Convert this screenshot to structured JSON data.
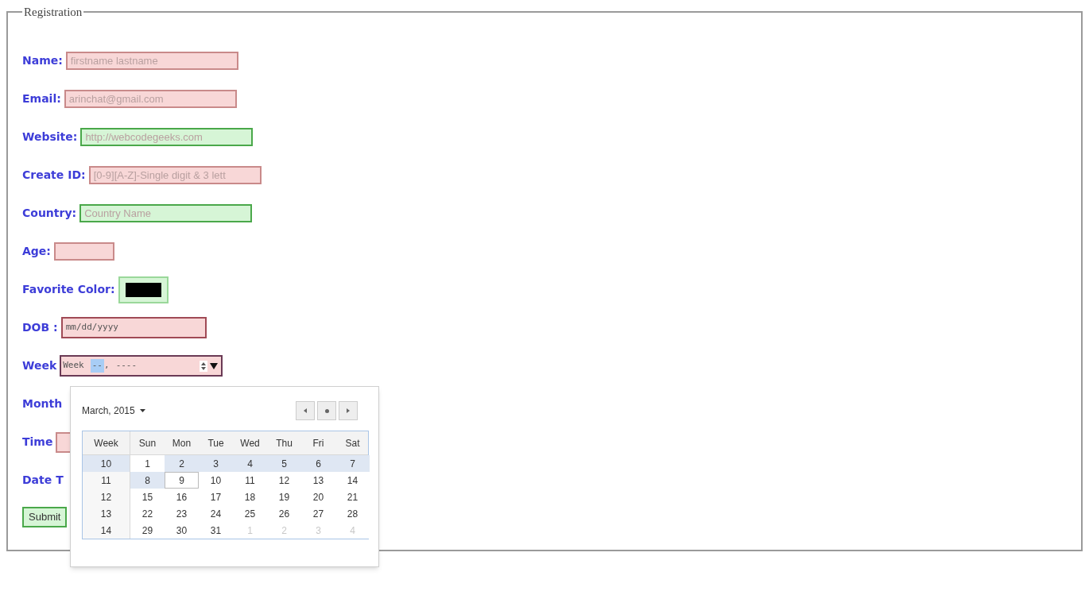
{
  "form": {
    "legend": "Registration",
    "fields": [
      {
        "kind": "text",
        "label": "Name:",
        "placeholder": "firstname lastname",
        "valid": false
      },
      {
        "kind": "text",
        "label": "Email:",
        "placeholder": "arinchat@gmail.com",
        "valid": false
      },
      {
        "kind": "text",
        "label": "Website:",
        "placeholder": "http://webcodegeeks.com",
        "valid": true
      },
      {
        "kind": "text",
        "label": "Create ID:",
        "placeholder": "[0-9][A-Z]-Single digit & 3 lett",
        "valid": false
      },
      {
        "kind": "text",
        "label": "Country:",
        "placeholder": "Country Name",
        "valid": true
      },
      {
        "kind": "number",
        "label": "Age:",
        "valid": false
      },
      {
        "kind": "color",
        "label": "Favorite Color:",
        "color": "#000000",
        "valid": true
      },
      {
        "kind": "date",
        "label": "DOB :",
        "placeholder": "mm/dd/yyyy",
        "valid": false
      },
      {
        "kind": "week",
        "label": "Week",
        "prefix": "Week",
        "week_value": "--",
        "separator": ",",
        "year_value": "----",
        "valid": false
      },
      {
        "kind": "hidden",
        "label": "Month"
      },
      {
        "kind": "time",
        "label": "Time",
        "valid": false
      },
      {
        "kind": "hidden",
        "label": "Date T"
      }
    ],
    "submit": {
      "label": "Submit",
      "valid": true
    }
  },
  "week_picker": {
    "month": "March, 2015",
    "columns": [
      "Week",
      "Sun",
      "Mon",
      "Tue",
      "Wed",
      "Thu",
      "Fri",
      "Sat"
    ],
    "rows": [
      {
        "week": "10",
        "selected": true,
        "days": [
          {
            "day": "1",
            "selected": false,
            "today": false,
            "dimmed": false
          },
          {
            "day": "2",
            "selected": true,
            "today": false,
            "dimmed": false
          },
          {
            "day": "3",
            "selected": true,
            "today": false,
            "dimmed": false
          },
          {
            "day": "4",
            "selected": true,
            "today": false,
            "dimmed": false
          },
          {
            "day": "5",
            "selected": true,
            "today": false,
            "dimmed": false
          },
          {
            "day": "6",
            "selected": true,
            "today": false,
            "dimmed": false
          },
          {
            "day": "7",
            "selected": true,
            "today": false,
            "dimmed": false
          }
        ]
      },
      {
        "week": "11",
        "selected": false,
        "days": [
          {
            "day": "8",
            "selected": true,
            "today": false,
            "dimmed": false
          },
          {
            "day": "9",
            "selected": false,
            "today": true,
            "dimmed": false
          },
          {
            "day": "10",
            "selected": false,
            "today": false,
            "dimmed": false
          },
          {
            "day": "11",
            "selected": false,
            "today": false,
            "dimmed": false
          },
          {
            "day": "12",
            "selected": false,
            "today": false,
            "dimmed": false
          },
          {
            "day": "13",
            "selected": false,
            "today": false,
            "dimmed": false
          },
          {
            "day": "14",
            "selected": false,
            "today": false,
            "dimmed": false
          }
        ]
      },
      {
        "week": "12",
        "selected": false,
        "days": [
          {
            "day": "15",
            "selected": false,
            "today": false,
            "dimmed": false
          },
          {
            "day": "16",
            "selected": false,
            "today": false,
            "dimmed": false
          },
          {
            "day": "17",
            "selected": false,
            "today": false,
            "dimmed": false
          },
          {
            "day": "18",
            "selected": false,
            "today": false,
            "dimmed": false
          },
          {
            "day": "19",
            "selected": false,
            "today": false,
            "dimmed": false
          },
          {
            "day": "20",
            "selected": false,
            "today": false,
            "dimmed": false
          },
          {
            "day": "21",
            "selected": false,
            "today": false,
            "dimmed": false
          }
        ]
      },
      {
        "week": "13",
        "selected": false,
        "days": [
          {
            "day": "22",
            "selected": false,
            "today": false,
            "dimmed": false
          },
          {
            "day": "23",
            "selected": false,
            "today": false,
            "dimmed": false
          },
          {
            "day": "24",
            "selected": false,
            "today": false,
            "dimmed": false
          },
          {
            "day": "25",
            "selected": false,
            "today": false,
            "dimmed": false
          },
          {
            "day": "26",
            "selected": false,
            "today": false,
            "dimmed": false
          },
          {
            "day": "27",
            "selected": false,
            "today": false,
            "dimmed": false
          },
          {
            "day": "28",
            "selected": false,
            "today": false,
            "dimmed": false
          }
        ]
      },
      {
        "week": "14",
        "selected": false,
        "days": [
          {
            "day": "29",
            "selected": false,
            "today": false,
            "dimmed": false
          },
          {
            "day": "30",
            "selected": false,
            "today": false,
            "dimmed": false
          },
          {
            "day": "31",
            "selected": false,
            "today": false,
            "dimmed": false
          },
          {
            "day": "1",
            "selected": false,
            "today": false,
            "dimmed": true
          },
          {
            "day": "2",
            "selected": false,
            "today": false,
            "dimmed": true
          },
          {
            "day": "3",
            "selected": false,
            "today": false,
            "dimmed": true
          },
          {
            "day": "4",
            "selected": false,
            "today": false,
            "dimmed": true
          }
        ]
      }
    ]
  }
}
